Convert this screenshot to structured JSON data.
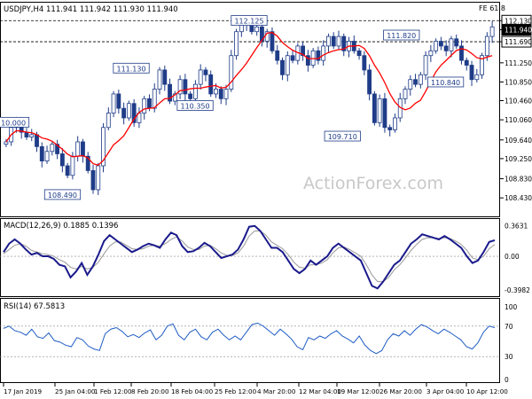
{
  "main_panel": {
    "label": "USDJPY,H4  111.941 111.942 111.930 111.940",
    "fib_label": "FE 61.8",
    "watermark": "ActionForex.com"
  },
  "macd_panel": {
    "label": "MACD(12,26,9) 0.1885 0.1396"
  },
  "rsi_panel": {
    "label": "RSI(14) 67.5813"
  },
  "chart_data": [
    {
      "type": "candlestick",
      "symbol": "USDJPY",
      "timeframe": "H4",
      "ohlc_last": {
        "open": 111.941,
        "high": 111.942,
        "low": 111.93,
        "close": 111.94
      },
      "ylim": [
        108.1,
        112.45
      ],
      "y_ticks": [
        "112.130",
        "111.940",
        "111.690",
        "111.250",
        "110.850",
        "110.460",
        "110.060",
        "109.640",
        "109.250",
        "108.830",
        "108.430"
      ],
      "x_ticks": [
        "17 Jan 2019",
        "25 Jan 04:00",
        "1 Feb 12:00",
        "8 Feb 20:00",
        "18 Feb 04:00",
        "25 Feb 12:00",
        "4 Mar 20:00",
        "12 Mar 04:00",
        "19 Mar 12:00",
        "26 Mar 20:00",
        "3 Apr 04:00",
        "10 Apr 12:00"
      ],
      "close_prices": [
        109.6,
        109.9,
        110.0,
        109.8,
        109.7,
        109.75,
        109.5,
        109.2,
        109.4,
        109.55,
        109.35,
        109.1,
        108.9,
        109.3,
        109.6,
        109.3,
        109.0,
        108.6,
        109.1,
        109.9,
        110.2,
        110.6,
        110.3,
        110.1,
        110.4,
        110.0,
        110.2,
        110.5,
        110.3,
        110.7,
        111.1,
        110.8,
        110.45,
        110.6,
        110.9,
        110.6,
        110.5,
        110.8,
        111.1,
        111.0,
        110.6,
        110.7,
        110.5,
        110.7,
        111.4,
        111.9,
        112.05,
        112.1,
        111.9,
        112.0,
        111.7,
        111.9,
        111.5,
        111.3,
        111.0,
        111.4,
        111.3,
        111.6,
        111.4,
        111.2,
        111.5,
        111.3,
        111.6,
        111.8,
        111.6,
        111.8,
        111.5,
        111.7,
        111.5,
        111.4,
        111.1,
        110.6,
        110.0,
        110.5,
        109.9,
        109.85,
        110.1,
        110.5,
        110.7,
        110.9,
        110.8,
        111.0,
        111.4,
        111.5,
        111.7,
        111.6,
        111.5,
        111.75,
        111.6,
        111.3,
        111.2,
        110.9,
        111.0,
        111.4,
        111.8,
        112.0
      ],
      "annotations": [
        {
          "label": "112.125",
          "value": 112.125
        },
        {
          "label": "111.820",
          "value": 111.82
        },
        {
          "label": "111.130",
          "value": 111.13
        },
        {
          "label": "110.350",
          "value": 110.35
        },
        {
          "label": "110.840",
          "value": 110.84
        },
        {
          "label": "109.710",
          "value": 109.71
        },
        {
          "label": "10.000",
          "value": 110.0
        },
        {
          "label": "108.490",
          "value": 108.49
        }
      ],
      "horizontal_lines": [
        112.13,
        111.69
      ],
      "current_price": 111.94,
      "moving_average_color": "#ff0000",
      "candle_color": "#1f3c88"
    },
    {
      "type": "line",
      "name": "MACD(12,26,9)",
      "ylim": [
        -0.43,
        0.41
      ],
      "y_ticks": [
        "0.3631",
        "0.00",
        "-0.3982"
      ],
      "values": [
        0.05,
        0.15,
        0.2,
        0.15,
        0.08,
        0.02,
        0.04,
        0.0,
        0.0,
        -0.03,
        -0.1,
        -0.12,
        -0.25,
        -0.18,
        -0.08,
        -0.22,
        -0.12,
        0.02,
        0.18,
        0.25,
        0.2,
        0.15,
        0.1,
        0.05,
        0.08,
        0.12,
        0.15,
        0.13,
        0.1,
        0.2,
        0.28,
        0.25,
        0.12,
        0.05,
        0.06,
        0.1,
        0.16,
        0.12,
        0.05,
        -0.02,
        0.0,
        0.02,
        0.08,
        0.2,
        0.35,
        0.36,
        0.3,
        0.2,
        0.1,
        0.1,
        0.05,
        -0.05,
        -0.15,
        -0.2,
        -0.15,
        -0.05,
        -0.1,
        -0.05,
        0.0,
        0.1,
        0.15,
        0.1,
        0.05,
        0.0,
        -0.05,
        -0.2,
        -0.35,
        -0.38,
        -0.3,
        -0.2,
        -0.1,
        -0.05,
        0.05,
        0.15,
        0.2,
        0.26,
        0.24,
        0.22,
        0.2,
        0.24,
        0.2,
        0.15,
        0.1,
        0.0,
        -0.08,
        -0.05,
        0.05,
        0.17,
        0.19
      ],
      "signal_values": [
        0.03,
        0.08,
        0.13,
        0.15,
        0.12,
        0.07,
        0.05,
        0.03,
        0.02,
        0.0,
        -0.04,
        -0.07,
        -0.13,
        -0.15,
        -0.12,
        -0.15,
        -0.13,
        -0.07,
        0.03,
        0.12,
        0.17,
        0.17,
        0.13,
        0.09,
        0.08,
        0.09,
        0.12,
        0.13,
        0.12,
        0.15,
        0.2,
        0.23,
        0.18,
        0.11,
        0.08,
        0.08,
        0.12,
        0.13,
        0.09,
        0.04,
        0.01,
        0.01,
        0.04,
        0.12,
        0.24,
        0.3,
        0.3,
        0.25,
        0.17,
        0.13,
        0.09,
        0.02,
        -0.07,
        -0.13,
        -0.14,
        -0.1,
        -0.1,
        -0.08,
        -0.04,
        0.04,
        0.1,
        0.11,
        0.08,
        0.04,
        0.0,
        -0.1,
        -0.22,
        -0.3,
        -0.3,
        -0.25,
        -0.16,
        -0.1,
        -0.02,
        0.07,
        0.14,
        0.2,
        0.22,
        0.22,
        0.21,
        0.22,
        0.21,
        0.18,
        0.14,
        0.07,
        -0.02,
        -0.04,
        0.0,
        0.09,
        0.14
      ],
      "line_color": "#1a1a8c",
      "signal_color": "#999999"
    },
    {
      "type": "line",
      "name": "RSI(14)",
      "ylim": [
        0,
        100
      ],
      "y_ticks": [
        "100",
        "70",
        "30",
        "0"
      ],
      "levels": [
        70,
        30
      ],
      "values": [
        67,
        70,
        64,
        62,
        58,
        66,
        56,
        54,
        61,
        51,
        49,
        45,
        43,
        55,
        52,
        44,
        40,
        38,
        60,
        66,
        68,
        63,
        56,
        59,
        55,
        61,
        65,
        52,
        58,
        70,
        73,
        58,
        52,
        62,
        66,
        56,
        52,
        62,
        66,
        58,
        52,
        57,
        52,
        62,
        72,
        74,
        70,
        64,
        58,
        66,
        60,
        53,
        43,
        39,
        55,
        52,
        57,
        54,
        60,
        64,
        57,
        53,
        48,
        57,
        45,
        38,
        34,
        38,
        52,
        60,
        57,
        64,
        58,
        66,
        72,
        69,
        64,
        60,
        66,
        62,
        57,
        52,
        43,
        40,
        48,
        62,
        70,
        68
      ],
      "line_color": "#1f5cc4"
    }
  ]
}
